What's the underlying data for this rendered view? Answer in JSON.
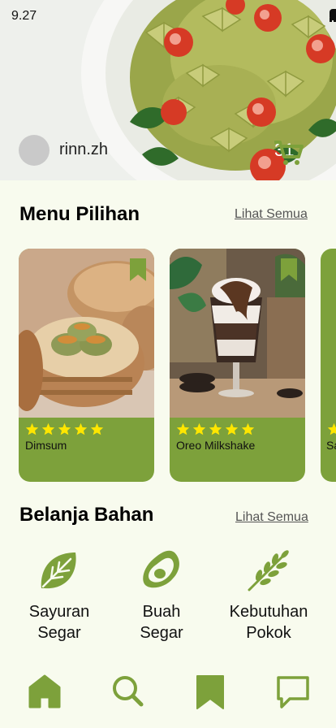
{
  "status_bar": {
    "time": "9.27"
  },
  "user": {
    "name": "rinn.zh"
  },
  "cart": {
    "count": "31"
  },
  "menu_section": {
    "title": "Menu Pilihan",
    "see_all": "Lihat Semua",
    "items": [
      {
        "name": "Dimsum",
        "rating": 5
      },
      {
        "name": "Oreo Milkshake",
        "rating": 5
      },
      {
        "name": "Sa",
        "rating": 5
      }
    ]
  },
  "shop_section": {
    "title": "Belanja Bahan",
    "see_all": "Lihat Semua",
    "categories": [
      {
        "label": "Sayuran\nSegar",
        "icon": "leaf-icon"
      },
      {
        "label": "Buah\nSegar",
        "icon": "avocado-icon"
      },
      {
        "label": "Kebutuhan\nPokok",
        "icon": "wheat-icon"
      }
    ]
  },
  "nav": {
    "items": [
      {
        "name": "home",
        "icon": "home-icon",
        "active": true
      },
      {
        "name": "search",
        "icon": "search-icon"
      },
      {
        "name": "bookmark",
        "icon": "bookmark-icon"
      },
      {
        "name": "chat",
        "icon": "chat-icon"
      }
    ]
  },
  "colors": {
    "accent": "#7da13b",
    "background": "#f8fbee",
    "star": "#ffe600"
  }
}
